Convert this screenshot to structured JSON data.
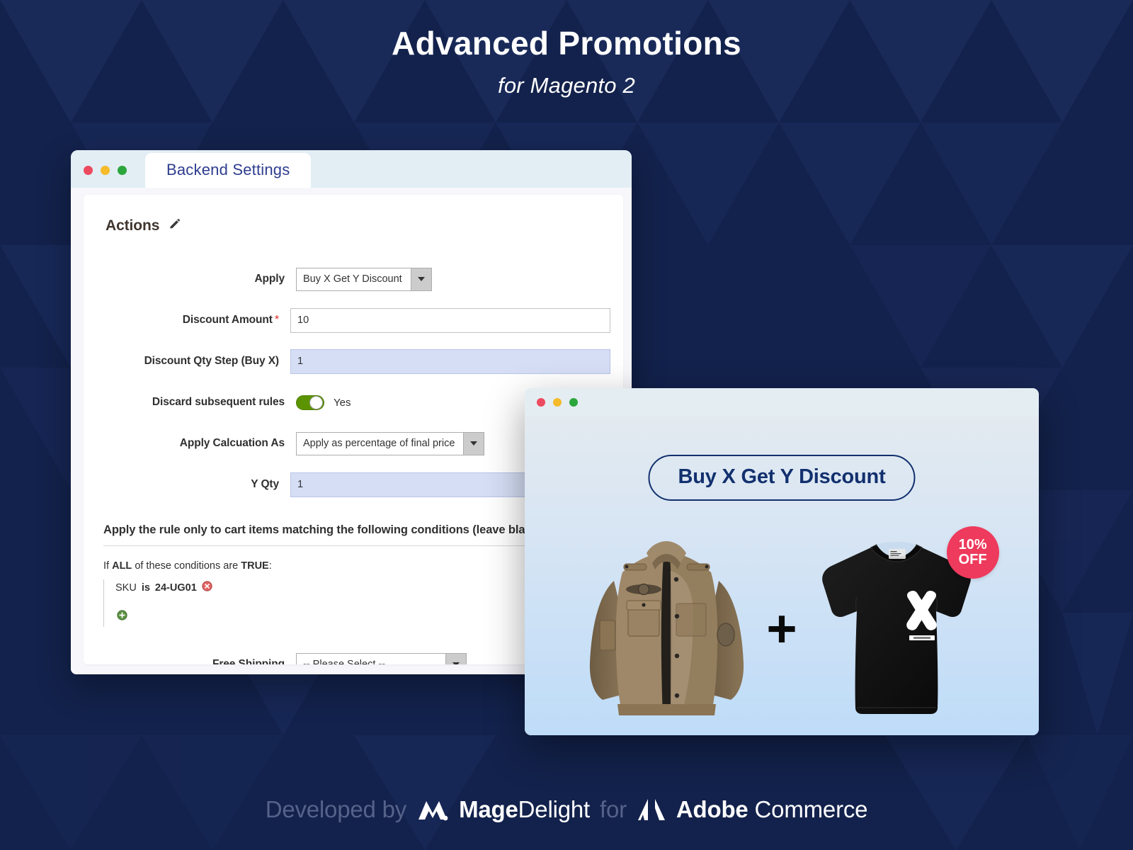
{
  "header": {
    "title": "Advanced Promotions",
    "subtitle": "for Magento 2"
  },
  "settings_window": {
    "traffic_lights": [
      "close",
      "minimize",
      "maximize"
    ],
    "tab_label": "Backend Settings",
    "section": {
      "title": "Actions",
      "edit_icon": "pencil-icon"
    },
    "fields": {
      "apply": {
        "label": "Apply",
        "value": "Buy X Get Y Discount",
        "type": "select"
      },
      "discount_amount": {
        "label": "Discount Amount",
        "required_marker": "*",
        "value": "10",
        "type": "text"
      },
      "discount_qty_step": {
        "label": "Discount Qty Step (Buy X)",
        "value": "1",
        "type": "text",
        "highlighted": true
      },
      "discard_subsequent": {
        "label": "Discard subsequent rules",
        "value": "Yes",
        "toggle_on": true,
        "type": "toggle"
      },
      "apply_calculation_as": {
        "label": "Apply Calcuation As",
        "value": "Apply as percentage of final price",
        "type": "select"
      },
      "y_qty": {
        "label": "Y Qty",
        "value": "1",
        "type": "text",
        "highlighted": true
      },
      "free_shipping": {
        "label": "Free Shipping",
        "value": "-- Please Select --",
        "type": "select"
      }
    },
    "conditions": {
      "heading": "Apply the rule only to cart items matching the following conditions (leave bla",
      "intro_prefix": "If",
      "intro_all": "ALL",
      "intro_mid": "of these conditions are",
      "intro_true": "TRUE",
      "intro_colon": ":",
      "rows": [
        {
          "attribute": "SKU",
          "operator": "is",
          "value": "24-UG01",
          "remove_icon": "remove-condition-icon"
        }
      ],
      "add_icon": "add-condition-icon"
    }
  },
  "showcase_window": {
    "traffic_lights": [
      "close",
      "minimize",
      "maximize"
    ],
    "promo_label": "Buy X Get Y Discount",
    "separator": "+",
    "products": [
      {
        "name": "khaki-jacket",
        "alt": "Khaki military style jacket"
      },
      {
        "name": "black-tshirt",
        "alt": "Black t-shirt with white X graphic"
      }
    ],
    "badge": {
      "line1": "10%",
      "line2": "OFF"
    }
  },
  "footer": {
    "developed_by": "Developed by",
    "magedelight_bold": "Mage",
    "magedelight_thin": "Delight",
    "for": "for",
    "adobe_bold": "Adobe",
    "adobe_thin": "Commerce"
  },
  "colors": {
    "background": "#13224C",
    "accent_navy": "#12306E",
    "tab_text": "#2E3D8F",
    "badge_red": "#EE3A5C",
    "toggle_green": "#5C9300",
    "required_red": "#E02B27",
    "highlight_field": "#D5DEF5"
  }
}
